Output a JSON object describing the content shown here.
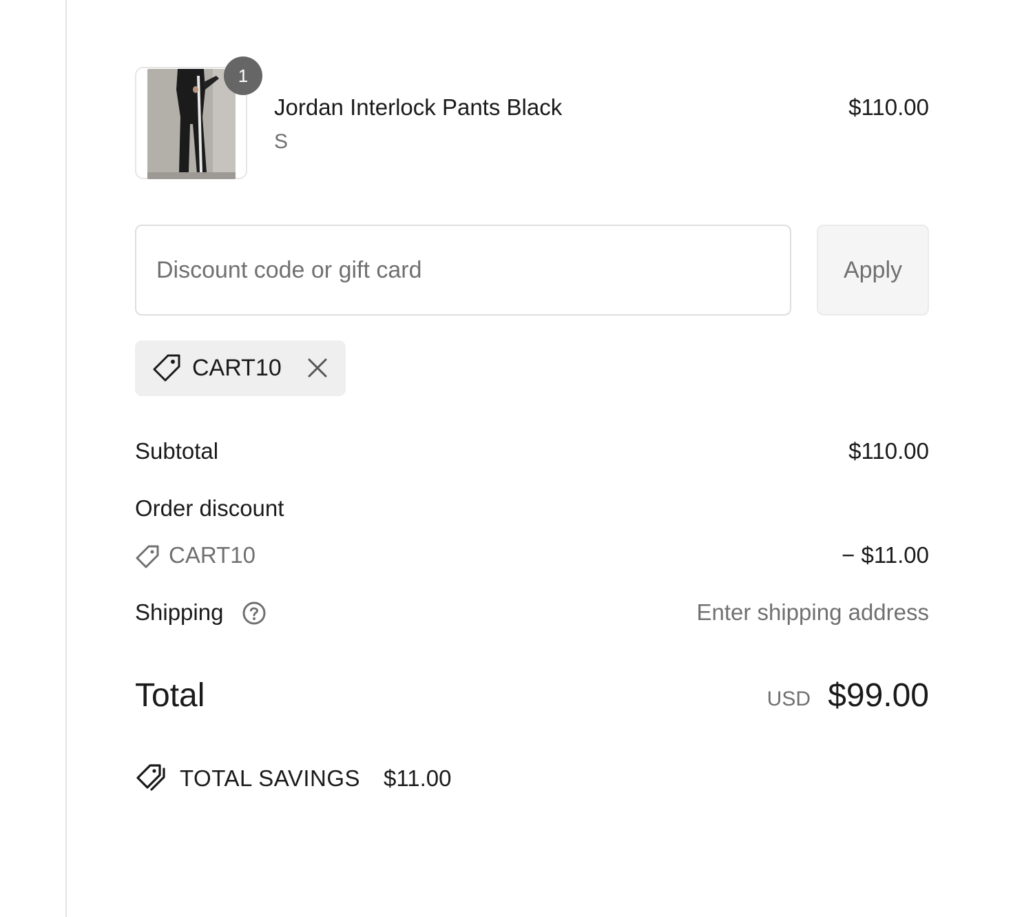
{
  "line_item": {
    "quantity": "1",
    "name": "Jordan Interlock Pants Black",
    "variant": "S",
    "price": "$110.00"
  },
  "discount": {
    "placeholder": "Discount code or gift card",
    "apply_label": "Apply",
    "applied_code": "CART10"
  },
  "totals": {
    "subtotal_label": "Subtotal",
    "subtotal_value": "$110.00",
    "order_discount_label": "Order discount",
    "discount_code": "CART10",
    "discount_value": "− $11.00",
    "shipping_label": "Shipping",
    "shipping_value": "Enter shipping address",
    "total_label": "Total",
    "currency": "USD",
    "total_value": "$99.00",
    "savings_label": "TOTAL SAVINGS",
    "savings_value": "$11.00"
  },
  "icons": {
    "tag": "tag-icon",
    "remove": "close-icon",
    "help": "help-circle-icon",
    "savings": "tags-icon"
  },
  "colors": {
    "text": "#1a1a1a",
    "muted": "#707070",
    "badge": "#666666",
    "chip_bg": "#efefef",
    "border": "#dedede"
  }
}
